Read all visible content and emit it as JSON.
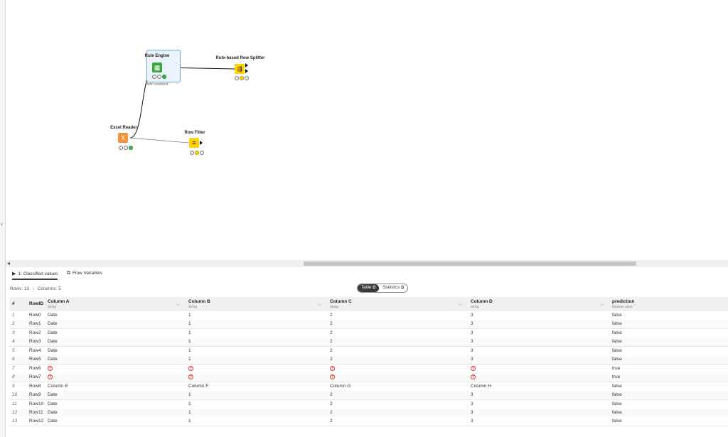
{
  "workflow": {
    "nodes": [
      {
        "id": "rule_engine",
        "title": "Rule Engine",
        "comment": "Add comment"
      },
      {
        "id": "rule_splitter",
        "title": "Rule-based Row Splitter"
      },
      {
        "id": "excel_reader",
        "title": "Excel Reader"
      },
      {
        "id": "row_filter",
        "title": "Row Filter"
      }
    ]
  },
  "tabs": [
    {
      "label": "1: Classified values",
      "icon": "play-icon"
    },
    {
      "label": "Flow Variables",
      "icon": "flow-variables-icon"
    }
  ],
  "meta": {
    "rows": "Rows: 13",
    "columns": "Columns: 5"
  },
  "view_toggle": {
    "table": "Table",
    "statistics": "Statistics"
  },
  "table": {
    "headers": [
      {
        "name": "#",
        "type": ""
      },
      {
        "name": "RowID",
        "type": ""
      },
      {
        "name": "Column A",
        "type": "String"
      },
      {
        "name": "Column B",
        "type": "String"
      },
      {
        "name": "Column C",
        "type": "String"
      },
      {
        "name": "Column D",
        "type": "String"
      },
      {
        "name": "prediction",
        "type": "Boolean value"
      }
    ],
    "rows": [
      [
        "1",
        "Row0",
        "Date",
        "1",
        "2",
        "3",
        "false"
      ],
      [
        "2",
        "Row1",
        "Date",
        "1",
        "2",
        "3",
        "false"
      ],
      [
        "3",
        "Row2",
        "Date",
        "1",
        "2",
        "3",
        "false"
      ],
      [
        "4",
        "Row3",
        "Date",
        "1",
        "2",
        "3",
        "false"
      ],
      [
        "5",
        "Row4",
        "Date",
        "1",
        "2",
        "3",
        "false"
      ],
      [
        "6",
        "Row5",
        "Date",
        "1",
        "2",
        "3",
        "false"
      ],
      [
        "7",
        "Row6",
        "?",
        "?",
        "?",
        "?",
        "true"
      ],
      [
        "8",
        "Row7",
        "?",
        "?",
        "?",
        "?",
        "true"
      ],
      [
        "9",
        "Row8",
        "Column E",
        "Column F",
        "Column G",
        "Column H",
        "false"
      ],
      [
        "10",
        "Row9",
        "Date",
        "1",
        "2",
        "3",
        "false"
      ],
      [
        "11",
        "Row10",
        "Date",
        "1",
        "2",
        "3",
        "false"
      ],
      [
        "12",
        "Row11",
        "Date",
        "1",
        "2",
        "3",
        "false"
      ],
      [
        "13",
        "Row12",
        "Date",
        "1",
        "2",
        "3",
        "false"
      ]
    ]
  },
  "colors": {
    "accent": "#3e3a39",
    "selection": "#6fa3d9",
    "missing": "#d43c3c"
  }
}
